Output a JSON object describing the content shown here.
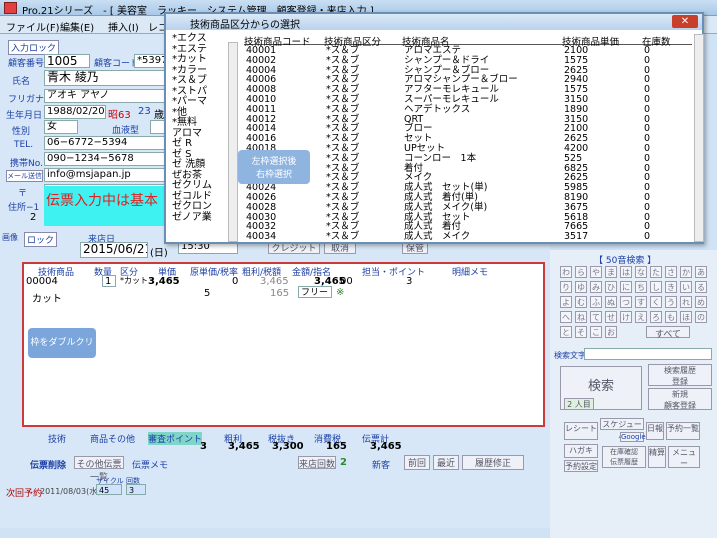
{
  "window": {
    "title": "Pro.21シリーズ　- [ 美容室　ラッキー　システム管理　顧客登録・来店入力 ]"
  },
  "menu": [
    "ファイル(F)",
    "編集(E)",
    "挿入(I)",
    "レコ"
  ],
  "customer": {
    "nyuryoku_lock": "入力ロック",
    "kokyaku_label": "顧客番号",
    "kokyaku_no": "1005",
    "code_label": "顧客コード",
    "code": "*5397",
    "name_label": "氏名",
    "name": "青木 綾乃",
    "furigana_label": "フリガナ",
    "furigana": "アオキ アヤノ",
    "birth_label": "生年月日",
    "birth": "1988/02/20",
    "era": "昭63",
    "age": "23",
    "age_unit": "歳",
    "sex_label": "性別",
    "sex": "女",
    "blood_label": "血液型",
    "tel_label": "TEL.",
    "tel": "06−6772−5394",
    "mobile_label": "携帯No.",
    "mobile": "090−1234−5678",
    "mail": "info@msjapan.jp",
    "mail_label": "メール送信",
    "zip_label": "〒",
    "zip": "543-0013",
    "addr_label": "住所−1",
    "addr2": "2",
    "banner": "伝票入力中は基本"
  },
  "overlay": {
    "title": "技術商品区分からの選択",
    "close": "✕",
    "categories": [
      "*エクス",
      "*エステ",
      "*カット",
      "*カラー",
      "*ス＆ブ",
      "*ストパ",
      "*パーマ",
      "*他",
      "*無料",
      "アロマ",
      "ゼ R",
      "ゼ S",
      "ゼ 洗顔",
      "ぜお茶",
      "ゼクリム",
      "ゼコルド",
      "ゼクロン",
      "ゼノア業"
    ],
    "headers": [
      "技術商品コード",
      "技術商品区分",
      "技術商品名",
      "技術商品単価",
      "在庫数"
    ],
    "rows": [
      [
        "40001",
        "*ス＆ブ",
        "アロマエステ",
        "2100",
        "0"
      ],
      [
        "40002",
        "*ス＆ブ",
        "シャンプー＆ドライ",
        "1575",
        "0"
      ],
      [
        "40004",
        "*ス＆ブ",
        "シャンプー＆ブロー",
        "2625",
        "0"
      ],
      [
        "40006",
        "*ス＆ブ",
        "アロマシャンプー＆ブロー",
        "2940",
        "0"
      ],
      [
        "40008",
        "*ス＆ブ",
        "アフターモレキュール",
        "1575",
        "0"
      ],
      [
        "40010",
        "*ス＆ブ",
        "スーパーモレキュール",
        "3150",
        "0"
      ],
      [
        "40011",
        "*ス＆ブ",
        "ヘアデトックス",
        "1890",
        "0"
      ],
      [
        "40012",
        "*ス＆ブ",
        "QRT",
        "3150",
        "0"
      ],
      [
        "40014",
        "*ス＆ブ",
        "ブロー",
        "2100",
        "0"
      ],
      [
        "40016",
        "*ス＆ブ",
        "セット",
        "2625",
        "0"
      ],
      [
        "40018",
        "*ス＆ブ",
        "UPセット",
        "4200",
        "0"
      ],
      [
        "40019",
        "*ス＆ブ",
        "コーンロー　1本",
        "525",
        "0"
      ],
      [
        "40020",
        "*ス＆ブ",
        "着付",
        "6825",
        "0"
      ],
      [
        "40022",
        "*ス＆ブ",
        "メイク",
        "2625",
        "0"
      ],
      [
        "40024",
        "*ス＆ブ",
        "成人式　セット(単)",
        "5985",
        "0"
      ],
      [
        "40026",
        "*ス＆ブ",
        "成人式　着付(単)",
        "8190",
        "0"
      ],
      [
        "40028",
        "*ス＆ブ",
        "成人式　メイク(単)",
        "3675",
        "0"
      ],
      [
        "40030",
        "*ス＆ブ",
        "成人式　セット",
        "5618",
        "0"
      ],
      [
        "40032",
        "*ス＆ブ",
        "成人式　着付",
        "7665",
        "0"
      ],
      [
        "40034",
        "*ス＆ブ",
        "成人式　メイク",
        "3517",
        "0"
      ]
    ],
    "tip": "左枠選択後\n右枠選択"
  },
  "visit": {
    "lock": "ロック",
    "visit_label": "来店日",
    "date": "2015/06/21",
    "day": "(日)",
    "time": "15:30",
    "credit": "クレジット",
    "cancel": "取消",
    "hokan": "保管"
  },
  "sales": {
    "headers": [
      "技術商品",
      "数量",
      "区分",
      "単価",
      "原単価/税率",
      "粗利/税額",
      "金額/指名",
      "担当・ポイント",
      "明細メモ"
    ],
    "row1": {
      "code": "00004",
      "qty": "1",
      "kubun": "*カット",
      "price": "3,465",
      "gen": "0",
      "arari": "3,465",
      "kingaku": "3,465",
      "tanto": "00",
      "point": "3"
    },
    "row2": {
      "name": "カット",
      "tax": "5",
      "zei": "165",
      "shimei": "フリー",
      "mark": "※"
    },
    "tip": "枠をダブルクリック"
  },
  "totals": {
    "headers": [
      "技術",
      "商品その他",
      "審査ポイント",
      "粗利",
      "税抜き",
      "消費税",
      "伝票計"
    ],
    "values": [
      "3",
      "3,465",
      "3,300",
      "165",
      "3,465"
    ],
    "denpyo_sakujo": "伝票削除",
    "list_btn": "その他伝票一覧",
    "memo": "伝票メモ",
    "raiten_label": "来店回数",
    "raiten": "2",
    "shinki": "新客",
    "prev": "前回",
    "last": "最近",
    "rireki": "履歴修正"
  },
  "next": {
    "label": "次回予約",
    "date": "2011/08/03(水)",
    "a": "45",
    "b": "3",
    "cycle": "サイクル",
    "kaisu": "回数"
  },
  "right": {
    "title": "【 50音検索 】",
    "kana": [
      "わ",
      "ら",
      "や",
      "ま",
      "は",
      "な",
      "た",
      "さ",
      "か",
      "あ",
      "り",
      "ゆ",
      "み",
      "ひ",
      "に",
      "ち",
      "し",
      "き",
      "い",
      "る",
      "よ",
      "む",
      "ふ",
      "ぬ",
      "つ",
      "す",
      "く",
      "う",
      "れ",
      "め",
      "へ",
      "ね",
      "て",
      "せ",
      "け",
      "え",
      "ろ",
      "も",
      "ほ",
      "の",
      "と",
      "そ",
      "こ",
      "お",
      "すべて"
    ],
    "search_label": "検索文字",
    "search": "検索",
    "count": "2 人目",
    "history": "検索履歴\n登録",
    "new": "新規\n顧客登録",
    "receipt": "レシート",
    "schedule": "スケジュール",
    "google": "Google",
    "daily": "日報",
    "yoyaku": "予約一覧",
    "hagaki": "ハガキ",
    "zaiko": "在庫確認\n伝票履歴",
    "menu": "メニュー",
    "kiroku": "精算",
    "jisseki": "予約\n実績",
    "osusume": "予約設定"
  }
}
